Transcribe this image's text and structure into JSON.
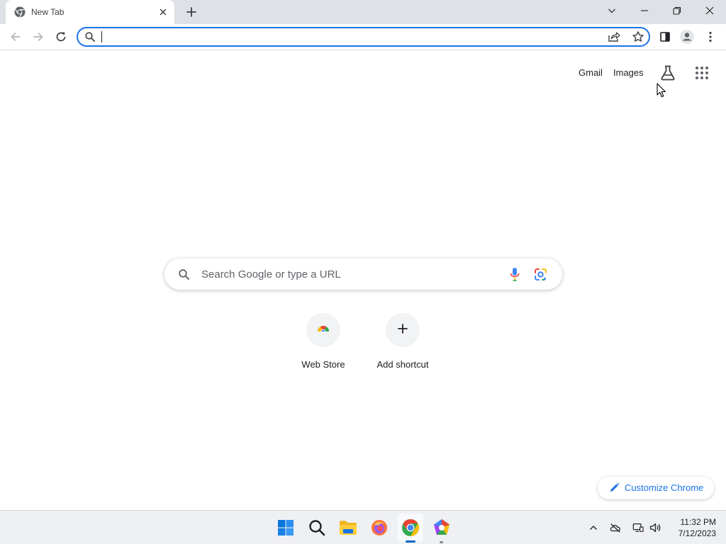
{
  "tab": {
    "title": "New Tab"
  },
  "omnibox": {
    "value": "",
    "placeholder": ""
  },
  "top_links": {
    "gmail": "Gmail",
    "images": "Images"
  },
  "search": {
    "placeholder": "Search Google or type a URL"
  },
  "shortcuts": [
    {
      "label": "Web Store",
      "icon": "chrome-web-store-icon"
    },
    {
      "label": "Add shortcut",
      "icon": "plus-icon"
    }
  ],
  "customize": {
    "label": "Customize Chrome"
  },
  "taskbar": {
    "apps": [
      "windows-start-icon",
      "search-icon",
      "file-explorer-icon",
      "firefox-icon",
      "chrome-icon",
      "app-icon"
    ],
    "active_app": "chrome-icon"
  },
  "clock": {
    "time": "11:32 PM",
    "date": "7/12/2023"
  },
  "colors": {
    "accent": "#1a73e8",
    "tabstrip": "#dee1e6",
    "taskbar": "#eef0f4"
  }
}
